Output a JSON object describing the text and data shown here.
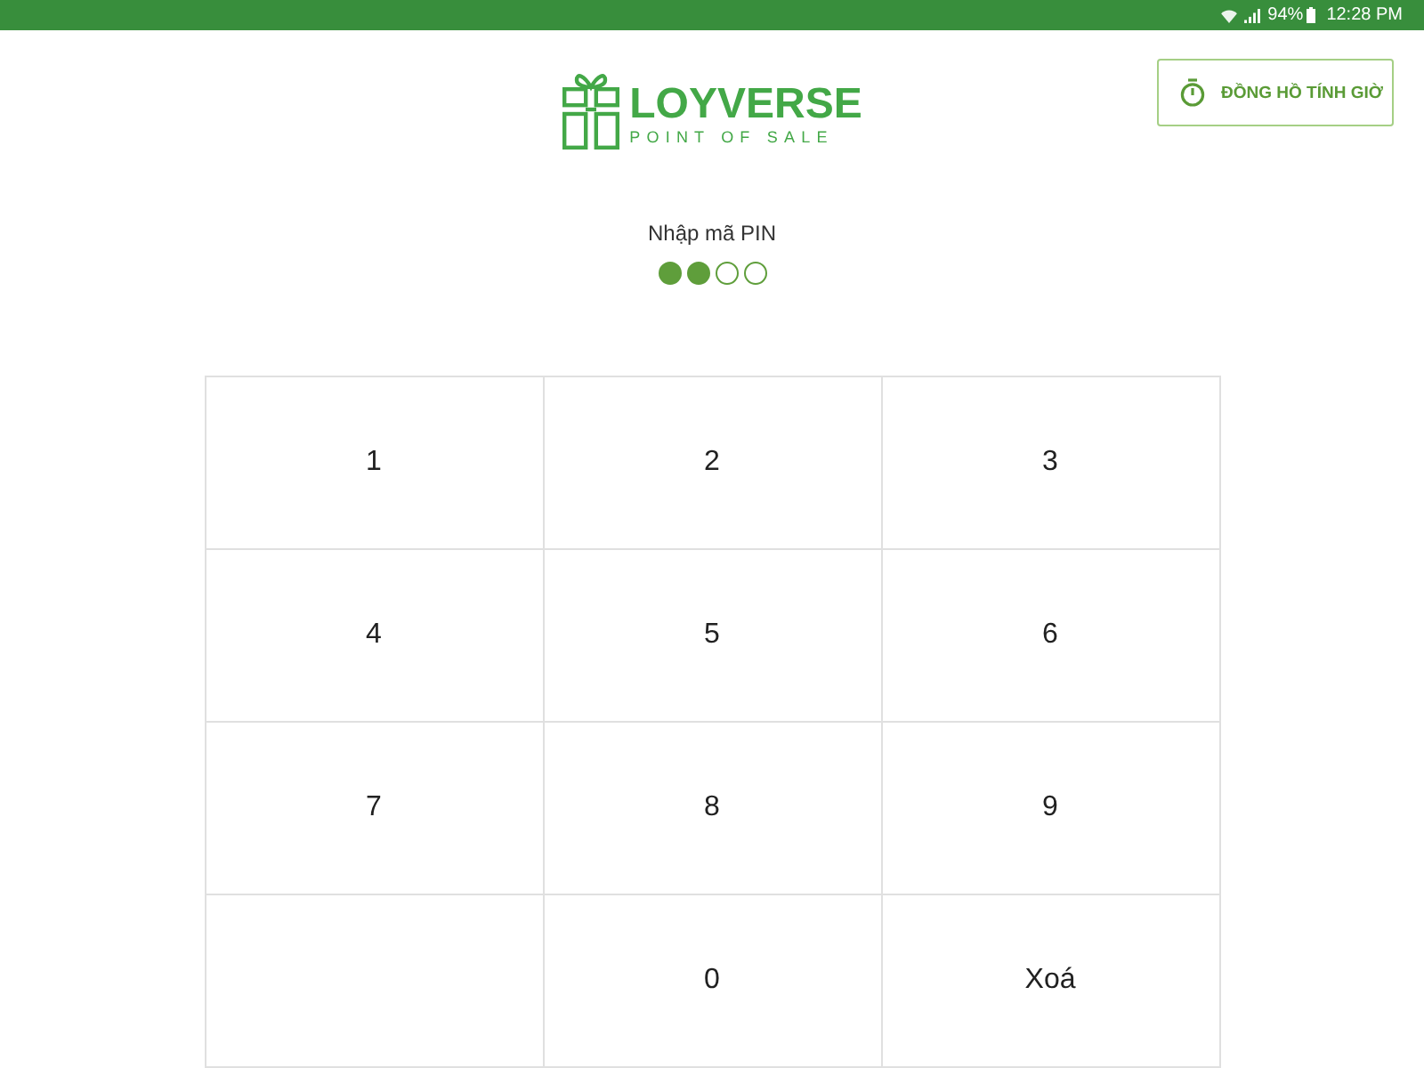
{
  "status_bar": {
    "battery": "94%",
    "time": "12:28 PM"
  },
  "header": {
    "logo": {
      "name": "LOYVERSE",
      "tagline": "POINT OF SALE"
    },
    "timeclock_button": "ĐỒNG HỒ TÍNH GIỜ"
  },
  "pin": {
    "label": "Nhập mã PIN",
    "dots": [
      {
        "filled": true
      },
      {
        "filled": true
      },
      {
        "filled": false
      },
      {
        "filled": false
      }
    ]
  },
  "keypad": {
    "keys": [
      {
        "kind": "digit",
        "label": "1"
      },
      {
        "kind": "digit",
        "label": "2"
      },
      {
        "kind": "digit",
        "label": "3"
      },
      {
        "kind": "digit",
        "label": "4"
      },
      {
        "kind": "digit",
        "label": "5"
      },
      {
        "kind": "digit",
        "label": "6"
      },
      {
        "kind": "digit",
        "label": "7"
      },
      {
        "kind": "digit",
        "label": "8"
      },
      {
        "kind": "digit",
        "label": "9"
      },
      {
        "kind": "blank"
      },
      {
        "kind": "digit",
        "label": "0"
      },
      {
        "kind": "action",
        "label": "Xoá"
      }
    ]
  }
}
